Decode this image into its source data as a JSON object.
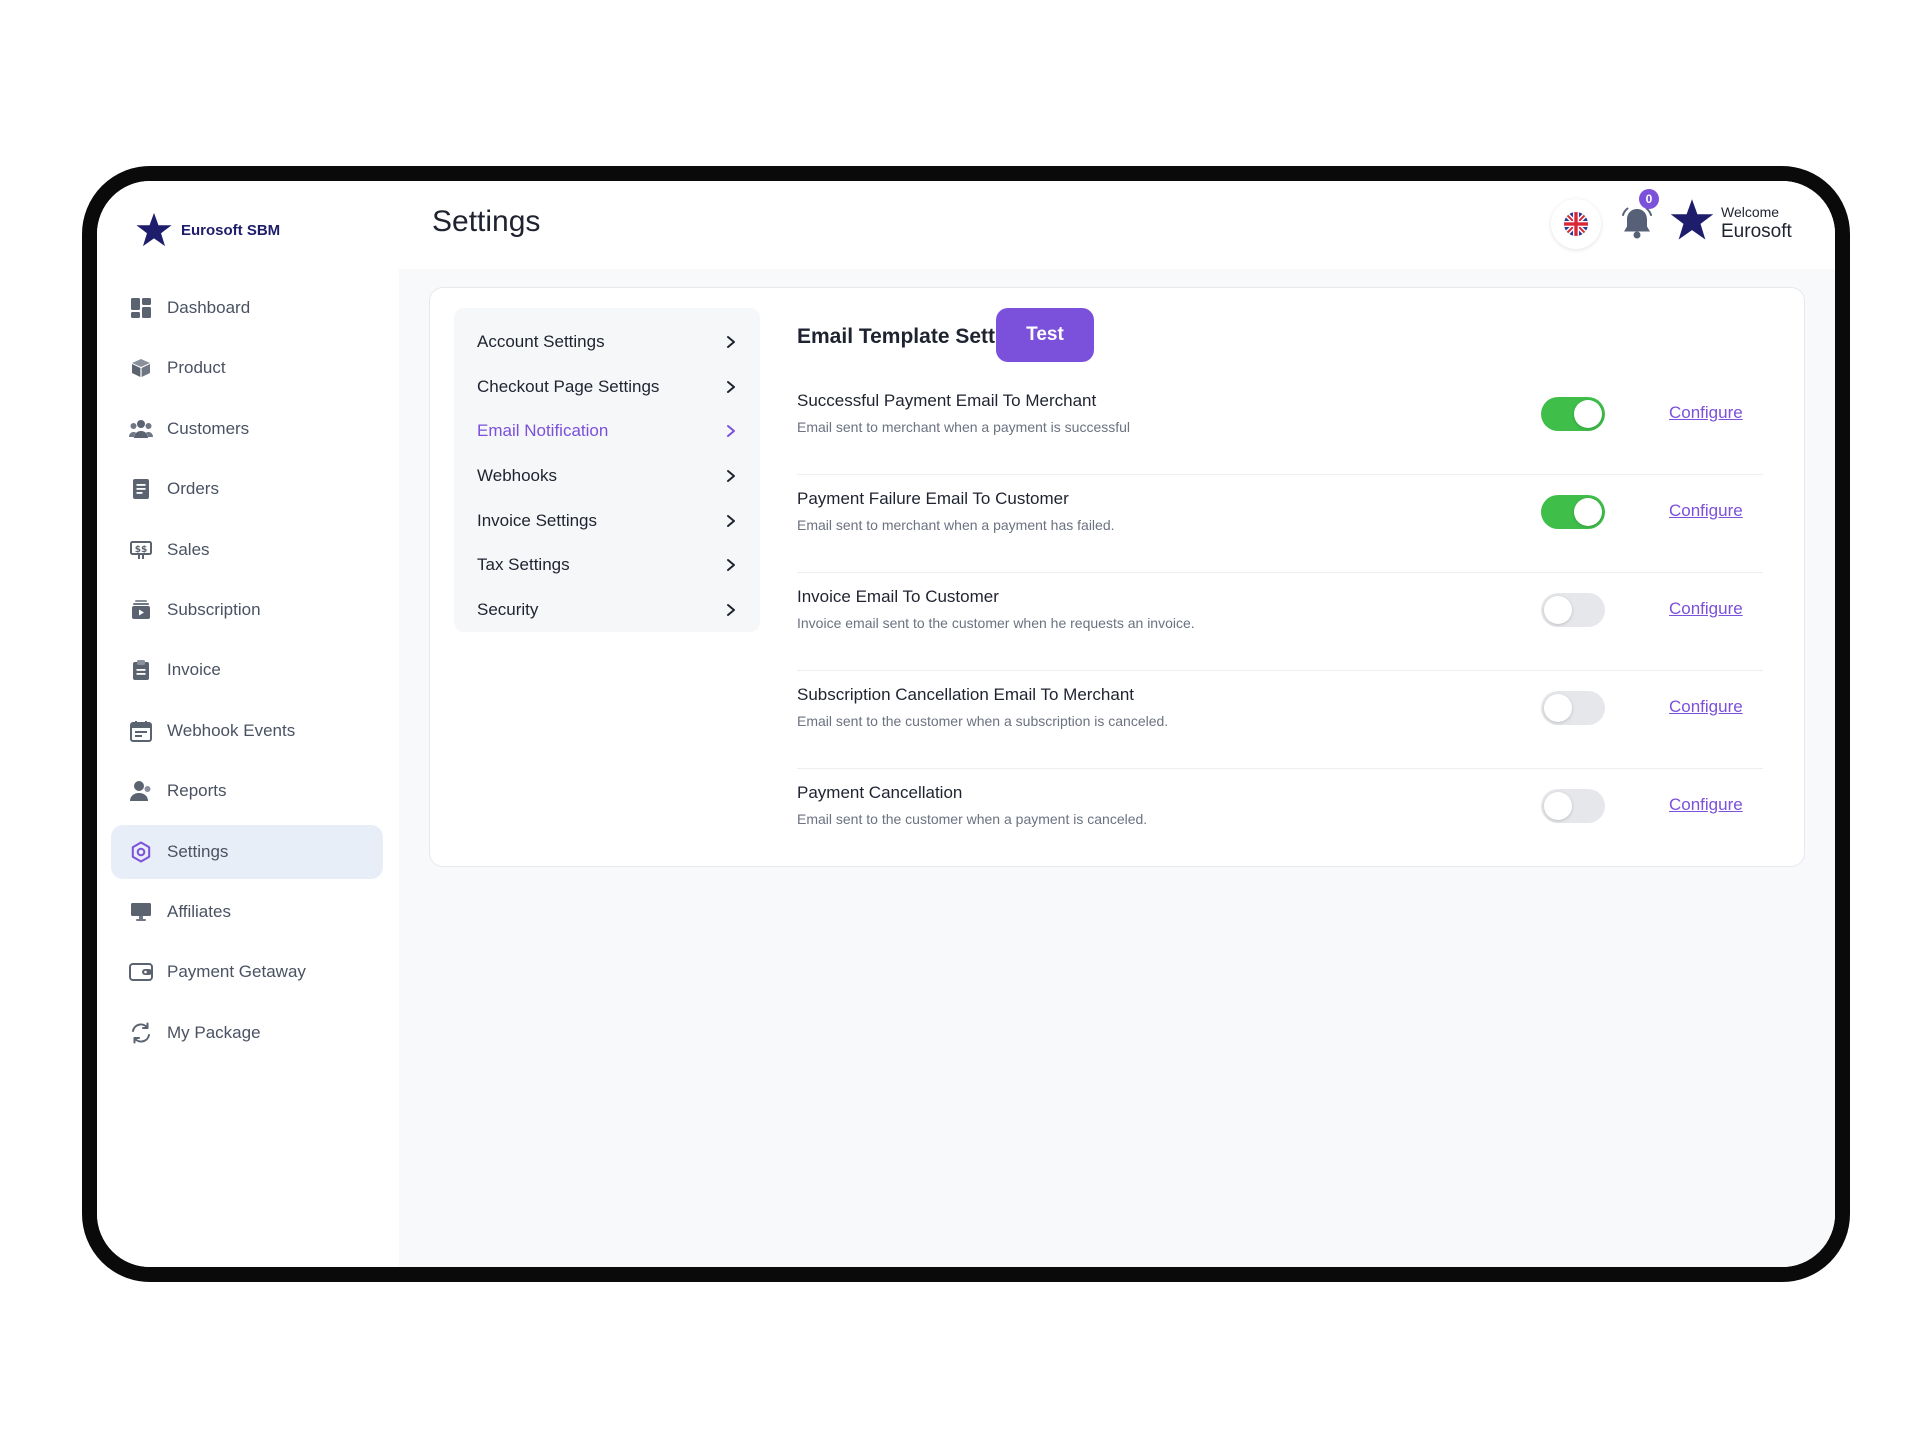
{
  "brand": {
    "name": "Eurosoft SBM"
  },
  "colors": {
    "accent": "#7b50db",
    "toggle_on": "#3fbe4a",
    "brand_navy": "#1e1d6b"
  },
  "nav": {
    "items": [
      {
        "label": "Dashboard",
        "icon": "dashboard-icon"
      },
      {
        "label": "Product",
        "icon": "box-icon"
      },
      {
        "label": "Customers",
        "icon": "users-icon"
      },
      {
        "label": "Orders",
        "icon": "document-icon"
      },
      {
        "label": "Sales",
        "icon": "money-icon"
      },
      {
        "label": "Subscription",
        "icon": "subscription-icon"
      },
      {
        "label": "Invoice",
        "icon": "clipboard-icon"
      },
      {
        "label": "Webhook Events",
        "icon": "calendar-icon"
      },
      {
        "label": "Reports",
        "icon": "user-icon"
      },
      {
        "label": "Settings",
        "icon": "gear-icon",
        "active": true
      },
      {
        "label": "Affiliates",
        "icon": "monitor-icon"
      },
      {
        "label": "Payment Getaway",
        "icon": "wallet-icon"
      },
      {
        "label": "My Package",
        "icon": "refresh-icon"
      }
    ]
  },
  "header": {
    "title": "Settings",
    "notifications_count": "0",
    "welcome": "Welcome",
    "user_name": "Eurosoft"
  },
  "settings_menu": {
    "items": [
      {
        "label": "Account Settings"
      },
      {
        "label": "Checkout Page Settings"
      },
      {
        "label": "Email Notification",
        "active": true
      },
      {
        "label": "Webhooks"
      },
      {
        "label": "Invoice Settings"
      },
      {
        "label": "Tax Settings"
      },
      {
        "label": "Security"
      }
    ]
  },
  "email_templates": {
    "title": "Email Template Settings",
    "test_label": "Test",
    "configure_label": "Configure",
    "rows": [
      {
        "title": "Successful Payment Email To Merchant",
        "desc": "Email sent to merchant when a payment is successful",
        "enabled": true
      },
      {
        "title": "Payment Failure Email To Customer",
        "desc": "Email sent to merchant when a payment has failed.",
        "enabled": true
      },
      {
        "title": "Invoice Email To Customer",
        "desc": "Invoice email sent to the customer when he requests an invoice.",
        "enabled": false
      },
      {
        "title": "Subscription Cancellation Email To Merchant",
        "desc": "Email sent to the customer when a subscription is canceled.",
        "enabled": false
      },
      {
        "title": "Payment Cancellation",
        "desc": "Email sent to the customer when a payment is canceled.",
        "enabled": false
      }
    ]
  }
}
